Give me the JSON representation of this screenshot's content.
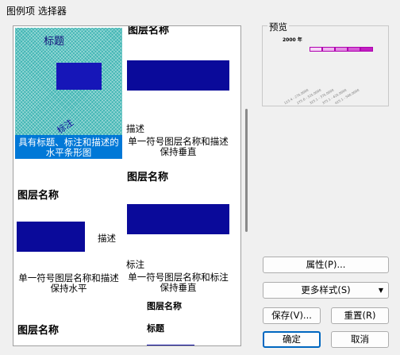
{
  "window": {
    "title": "图例项 选择器"
  },
  "gallery": {
    "items": [
      {
        "title": "标题",
        "note": "标注",
        "caption": "具有标题、标注和描述的水平条形图",
        "selected": true
      },
      {
        "title": "图层名称",
        "desc": "描述",
        "caption": "单一符号图层名称和描述\n保持垂直"
      },
      {
        "title": "图层名称",
        "desc": "描述",
        "caption": "单一符号图层名称和描述\n保持水平"
      },
      {
        "title": "图层名称",
        "note": "标注",
        "caption": "单一符号图层名称和标注\n保持垂直"
      },
      {
        "title": "图层名称"
      },
      {
        "title": "图层名称",
        "subtitle": "标题"
      }
    ],
    "header_partial": "图层名称"
  },
  "preview": {
    "label": "预览",
    "year": "2000 年",
    "swatch_colors": [
      "#f6d6f6",
      "#eeb4ee",
      "#e28ce2",
      "#d45ad4",
      "#c020c0"
    ],
    "tick_labels": [
      "123.4 - 275.0000",
      "275.0 - 325.0000",
      "325.1 - 375.0000",
      "375.1 - 425.0000",
      "425.1 - 500.0000"
    ]
  },
  "buttons": {
    "properties": "属性(P)...",
    "more_styles": "更多样式(S)",
    "save": "保存(V)...",
    "reset": "重置(R)",
    "ok": "确定",
    "cancel": "取消"
  }
}
